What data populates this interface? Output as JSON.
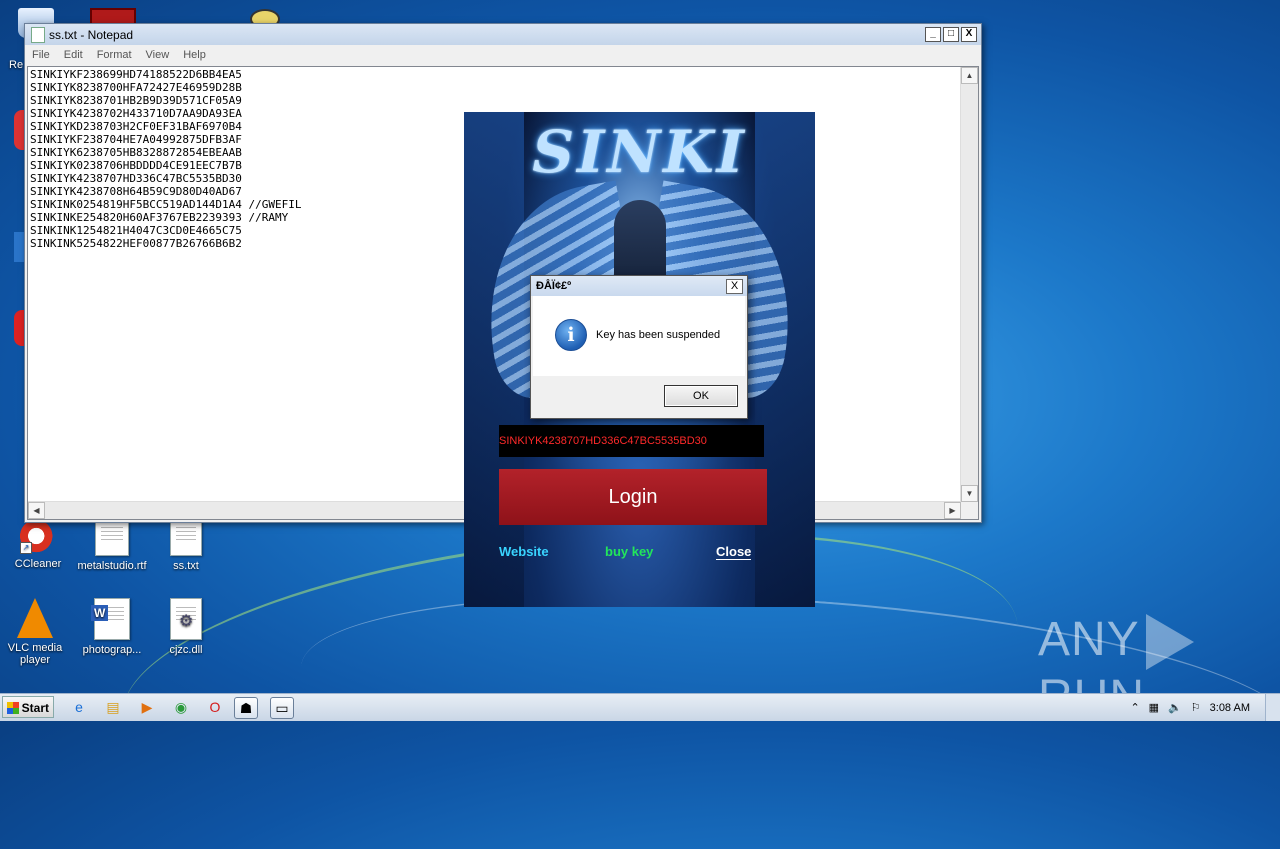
{
  "notepad": {
    "title": "ss.txt - Notepad",
    "menu": [
      "File",
      "Edit",
      "Format",
      "View",
      "Help"
    ],
    "content": "SINKIYKF238699HD74188522D6BB4EA5\nSINKIYK8238700HFA72427E46959D28B\nSINKIYK8238701HB2B9D39D571CF05A9\nSINKIYK4238702H433710D7AA9DA93EA\nSINKIYKD238703H2CF0EF31BAF6970B4\nSINKIYKF238704HE7A04992875DFB3AF\nSINKIYK6238705HB8328872854EBEAAB\nSINKIYK0238706HBDDDD4CE91EEC7B7B\nSINKIYK4238707HD336C47BC5535BD30\nSINKIYK4238708H64B59C9D80D40AD67\nSINKINK0254819HF5BCC519AD144D1A4 //GWEFIL\nSINKINKE254820H60AF3767EB2239393 //RAMY\nSINKINK1254821H4047C3CD0E4665C75\nSINKINK5254822HEF00877B26766B6B2",
    "controls": {
      "minimize": "_",
      "maximize": "□",
      "close": "X"
    }
  },
  "app": {
    "logo_text": "SINKI",
    "key_value": "SINKIYK4238707HD336C47BC5535BD30",
    "login_label": "Login",
    "links": {
      "website": "Website",
      "buy_key": "buy key",
      "close": "Close"
    }
  },
  "dialog": {
    "title": "ÐÅÏ¢£º",
    "message": "Key has been suspended",
    "ok_label": "OK",
    "close_glyph": "X"
  },
  "desktop": {
    "icons": [
      {
        "label": "CCleaner"
      },
      {
        "label": "metalstudio.rtf"
      },
      {
        "label": "ss.txt"
      },
      {
        "label": "VLC media player"
      },
      {
        "label": "photograp..."
      },
      {
        "label": "cjzc.dll"
      }
    ],
    "partial_label": "Re",
    "watermark": "ANY",
    "watermark2": "RUN"
  },
  "taskbar": {
    "start_label": "Start",
    "clock": "3:08 AM"
  },
  "colors": {
    "key_text": "#ff2a2a",
    "login_bg": "#a31a21",
    "website_link": "#39d4ff",
    "buy_link": "#22e65a"
  }
}
